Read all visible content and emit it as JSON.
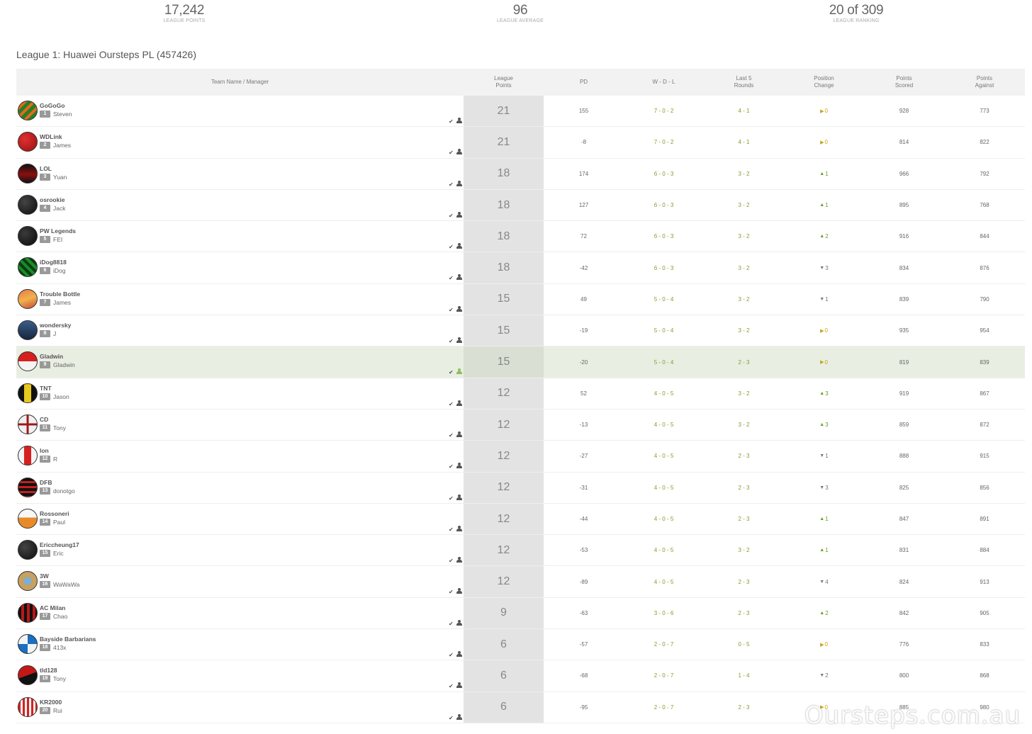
{
  "stats": {
    "league_points": {
      "value": "17,242",
      "label": "LEAGUE POINTS"
    },
    "league_average": {
      "value": "96",
      "label": "LEAGUE AVERAGE"
    },
    "league_ranking": {
      "value": "20 of 309",
      "label": "LEAGUE RANKING"
    }
  },
  "league_title": "League 1: Huawei Oursteps PL (457426)",
  "columns": {
    "team": "Team Name / Manager",
    "lp1": "League",
    "lp2": "Points",
    "pd": "PD",
    "wdl": "W - D - L",
    "l5a": "Last 5",
    "l5b": "Rounds",
    "pca": "Position",
    "pcb": "Change",
    "psa": "Points",
    "psb": "Scored",
    "paa": "Points",
    "pab": "Against"
  },
  "icons": {
    "tick": "checkmark-icon",
    "person": "person-icon",
    "up": "arrow-up-icon",
    "down": "arrow-down-icon",
    "same": "arrow-right-icon"
  },
  "colors": {
    "highlight_row": "#e9eee3",
    "league_points_column": "#e3e3e3",
    "positive": "#6a9e2a",
    "neutral": "#c8a21a"
  },
  "rows": [
    {
      "team": "GoGoGo",
      "rank": "1",
      "manager": "Steven",
      "lp": "21",
      "pd": "155",
      "wdl": "7 - 0 - 2",
      "l5": "4 - 1",
      "pc_dir": "same",
      "pc": "0",
      "ps": "928",
      "pa": "773"
    },
    {
      "team": "WDLink",
      "rank": "2",
      "manager": "James",
      "lp": "21",
      "pd": "-8",
      "wdl": "7 - 0 - 2",
      "l5": "4 - 1",
      "pc_dir": "same",
      "pc": "0",
      "ps": "814",
      "pa": "822"
    },
    {
      "team": "LOL",
      "rank": "3",
      "manager": "Yuan",
      "lp": "18",
      "pd": "174",
      "wdl": "6 - 0 - 3",
      "l5": "3 - 2",
      "pc_dir": "up",
      "pc": "1",
      "ps": "966",
      "pa": "792"
    },
    {
      "team": "osrookie",
      "rank": "4",
      "manager": "Jack",
      "lp": "18",
      "pd": "127",
      "wdl": "6 - 0 - 3",
      "l5": "3 - 2",
      "pc_dir": "up",
      "pc": "1",
      "ps": "895",
      "pa": "768"
    },
    {
      "team": "PW Legends",
      "rank": "5",
      "manager": "FEI",
      "lp": "18",
      "pd": "72",
      "wdl": "6 - 0 - 3",
      "l5": "3 - 2",
      "pc_dir": "up",
      "pc": "2",
      "ps": "916",
      "pa": "844"
    },
    {
      "team": "iDog8818",
      "rank": "6",
      "manager": "iDog",
      "lp": "18",
      "pd": "-42",
      "wdl": "6 - 0 - 3",
      "l5": "3 - 2",
      "pc_dir": "down",
      "pc": "3",
      "ps": "834",
      "pa": "876"
    },
    {
      "team": "Trouble Bottle",
      "rank": "7",
      "manager": "James",
      "lp": "15",
      "pd": "49",
      "wdl": "5 - 0 - 4",
      "l5": "3 - 2",
      "pc_dir": "down",
      "pc": "1",
      "ps": "839",
      "pa": "790"
    },
    {
      "team": "wondersky",
      "rank": "8",
      "manager": "J",
      "lp": "15",
      "pd": "-19",
      "wdl": "5 - 0 - 4",
      "l5": "3 - 2",
      "pc_dir": "same",
      "pc": "0",
      "ps": "935",
      "pa": "954"
    },
    {
      "team": "Gladwin",
      "rank": "9",
      "manager": "Gladwin",
      "lp": "15",
      "pd": "-20",
      "wdl": "5 - 0 - 4",
      "l5": "2 - 3",
      "pc_dir": "same",
      "pc": "0",
      "ps": "819",
      "pa": "839"
    },
    {
      "team": "TNT",
      "rank": "10",
      "manager": "Jason",
      "lp": "12",
      "pd": "52",
      "wdl": "4 - 0 - 5",
      "l5": "3 - 2",
      "pc_dir": "up",
      "pc": "3",
      "ps": "919",
      "pa": "867"
    },
    {
      "team": "CD",
      "rank": "11",
      "manager": "Tony",
      "lp": "12",
      "pd": "-13",
      "wdl": "4 - 0 - 5",
      "l5": "3 - 2",
      "pc_dir": "up",
      "pc": "3",
      "ps": "859",
      "pa": "872"
    },
    {
      "team": "lon",
      "rank": "12",
      "manager": "R",
      "lp": "12",
      "pd": "-27",
      "wdl": "4 - 0 - 5",
      "l5": "2 - 3",
      "pc_dir": "down",
      "pc": "1",
      "ps": "888",
      "pa": "915"
    },
    {
      "team": "DFB",
      "rank": "13",
      "manager": "donotgo",
      "lp": "12",
      "pd": "-31",
      "wdl": "4 - 0 - 5",
      "l5": "2 - 3",
      "pc_dir": "down",
      "pc": "3",
      "ps": "825",
      "pa": "856"
    },
    {
      "team": "Rossoneri",
      "rank": "14",
      "manager": "Paul",
      "lp": "12",
      "pd": "-44",
      "wdl": "4 - 0 - 5",
      "l5": "2 - 3",
      "pc_dir": "up",
      "pc": "1",
      "ps": "847",
      "pa": "891"
    },
    {
      "team": "Ericcheung17",
      "rank": "15",
      "manager": "Eric",
      "lp": "12",
      "pd": "-53",
      "wdl": "4 - 0 - 5",
      "l5": "3 - 2",
      "pc_dir": "up",
      "pc": "1",
      "ps": "831",
      "pa": "884"
    },
    {
      "team": "3W",
      "rank": "16",
      "manager": "WaWaWa",
      "lp": "12",
      "pd": "-89",
      "wdl": "4 - 0 - 5",
      "l5": "2 - 3",
      "pc_dir": "down",
      "pc": "4",
      "ps": "824",
      "pa": "913"
    },
    {
      "team": "AC Milan",
      "rank": "17",
      "manager": "Chao",
      "lp": "9",
      "pd": "-63",
      "wdl": "3 - 0 - 6",
      "l5": "2 - 3",
      "pc_dir": "up",
      "pc": "2",
      "ps": "842",
      "pa": "905"
    },
    {
      "team": "Bayside Barbarians",
      "rank": "18",
      "manager": "413x",
      "lp": "6",
      "pd": "-57",
      "wdl": "2 - 0 - 7",
      "l5": "0 - 5",
      "pc_dir": "same",
      "pc": "0",
      "ps": "776",
      "pa": "833"
    },
    {
      "team": "tld128",
      "rank": "19",
      "manager": "Tony",
      "lp": "6",
      "pd": "-68",
      "wdl": "2 - 0 - 7",
      "l5": "1 - 4",
      "pc_dir": "down",
      "pc": "2",
      "ps": "800",
      "pa": "868"
    },
    {
      "team": "KR2000",
      "rank": "20",
      "manager": "Rui",
      "lp": "6",
      "pd": "-95",
      "wdl": "2 - 0 - 7",
      "l5": "2 - 3",
      "pc_dir": "same",
      "pc": "0",
      "ps": "885",
      "pa": "980"
    }
  ],
  "watermark": "Oursteps.com.au"
}
